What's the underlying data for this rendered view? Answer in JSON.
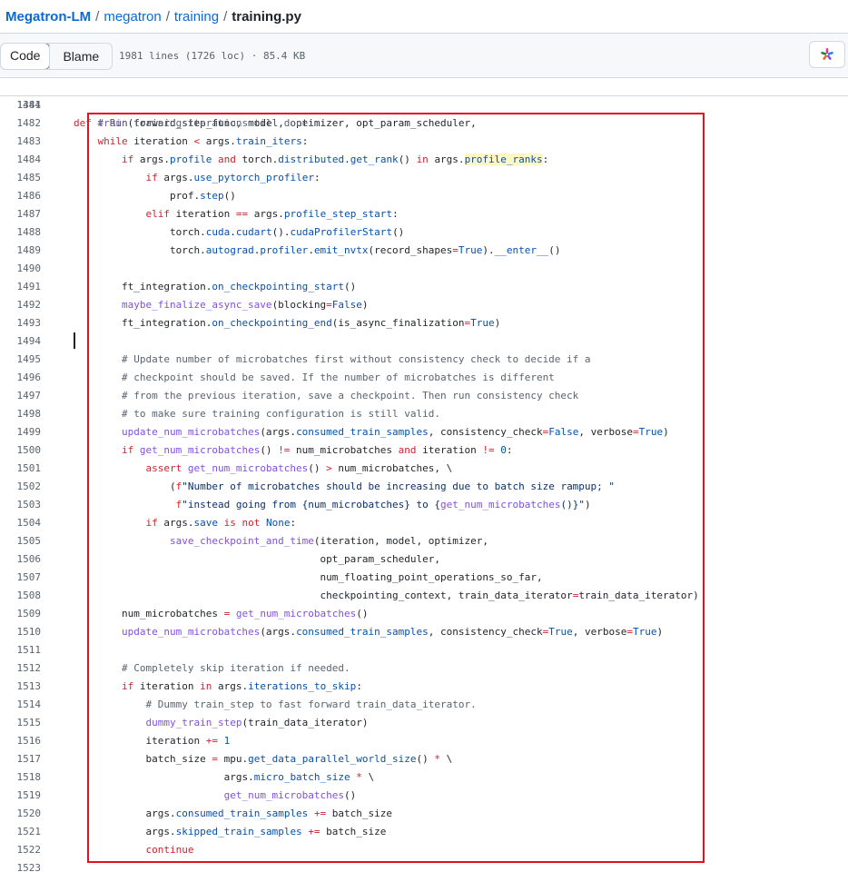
{
  "breadcrumb": {
    "repo": "Megatron-LM",
    "dir1": "megatron",
    "dir2": "training",
    "file": "training.py",
    "separator": "/"
  },
  "toolbar": {
    "code_tab": "Code",
    "blame_tab": "Blame",
    "file_meta": "1981 lines (1726 loc) · 85.4 KB",
    "copilot_icon": "copilot-sparkle-icon"
  },
  "annotation": {
    "box_color": "#e5101f"
  },
  "sticky_line": {
    "num": "1344",
    "tokens": [
      {
        "t": "def ",
        "c": "kw"
      },
      {
        "t": "train",
        "c": "fn"
      },
      {
        "t": "(forward_step_func, model, optimizer, opt_param_scheduler,",
        "c": ""
      }
    ]
  },
  "lines": [
    {
      "num": "1481",
      "indent": 0,
      "tokens": []
    },
    {
      "num": "1482",
      "indent": 4,
      "tokens": [
        {
          "t": "# Run training iterations till done.",
          "c": "cm"
        }
      ]
    },
    {
      "num": "1483",
      "indent": 4,
      "tokens": [
        {
          "t": "while ",
          "c": "kw"
        },
        {
          "t": "iteration ",
          "c": ""
        },
        {
          "t": "<",
          "c": "kw"
        },
        {
          "t": " args.",
          "c": ""
        },
        {
          "t": "train_iters",
          "c": "at"
        },
        {
          "t": ":",
          "c": ""
        }
      ]
    },
    {
      "num": "1484",
      "indent": 8,
      "tokens": [
        {
          "t": "if ",
          "c": "kw"
        },
        {
          "t": "args.",
          "c": ""
        },
        {
          "t": "profile ",
          "c": "at"
        },
        {
          "t": "and ",
          "c": "kw"
        },
        {
          "t": "torch.",
          "c": ""
        },
        {
          "t": "distributed",
          "c": "at"
        },
        {
          "t": ".",
          "c": ""
        },
        {
          "t": "get_rank",
          "c": "at"
        },
        {
          "t": "() ",
          "c": ""
        },
        {
          "t": "in ",
          "c": "kw"
        },
        {
          "t": "args.",
          "c": ""
        },
        {
          "t": "profile_ranks",
          "c": "at hl"
        },
        {
          "t": ":",
          "c": ""
        }
      ]
    },
    {
      "num": "1485",
      "indent": 12,
      "tokens": [
        {
          "t": "if ",
          "c": "kw"
        },
        {
          "t": "args.",
          "c": ""
        },
        {
          "t": "use_pytorch_profiler",
          "c": "at"
        },
        {
          "t": ":",
          "c": ""
        }
      ]
    },
    {
      "num": "1486",
      "indent": 16,
      "tokens": [
        {
          "t": "prof.",
          "c": ""
        },
        {
          "t": "step",
          "c": "at"
        },
        {
          "t": "()",
          "c": ""
        }
      ]
    },
    {
      "num": "1487",
      "indent": 12,
      "tokens": [
        {
          "t": "elif ",
          "c": "kw"
        },
        {
          "t": "iteration ",
          "c": ""
        },
        {
          "t": "==",
          "c": "kw"
        },
        {
          "t": " args.",
          "c": ""
        },
        {
          "t": "profile_step_start",
          "c": "at"
        },
        {
          "t": ":",
          "c": ""
        }
      ]
    },
    {
      "num": "1488",
      "indent": 16,
      "tokens": [
        {
          "t": "torch.",
          "c": ""
        },
        {
          "t": "cuda",
          "c": "at"
        },
        {
          "t": ".",
          "c": ""
        },
        {
          "t": "cudart",
          "c": "at"
        },
        {
          "t": "().",
          "c": ""
        },
        {
          "t": "cudaProfilerStart",
          "c": "at"
        },
        {
          "t": "()",
          "c": ""
        }
      ]
    },
    {
      "num": "1489",
      "indent": 16,
      "tokens": [
        {
          "t": "torch.",
          "c": ""
        },
        {
          "t": "autograd",
          "c": "at"
        },
        {
          "t": ".",
          "c": ""
        },
        {
          "t": "profiler",
          "c": "at"
        },
        {
          "t": ".",
          "c": ""
        },
        {
          "t": "emit_nvtx",
          "c": "at"
        },
        {
          "t": "(record_shapes",
          "c": ""
        },
        {
          "t": "=",
          "c": "kw"
        },
        {
          "t": "True",
          "c": "at"
        },
        {
          "t": ").",
          "c": ""
        },
        {
          "t": "__enter__",
          "c": "at"
        },
        {
          "t": "()",
          "c": ""
        }
      ]
    },
    {
      "num": "1490",
      "indent": 0,
      "tokens": []
    },
    {
      "num": "1491",
      "indent": 8,
      "tokens": [
        {
          "t": "ft_integration.",
          "c": ""
        },
        {
          "t": "on_checkpointing_start",
          "c": "at"
        },
        {
          "t": "()",
          "c": ""
        }
      ]
    },
    {
      "num": "1492",
      "indent": 8,
      "tokens": [
        {
          "t": "maybe_finalize_async_save",
          "c": "fn"
        },
        {
          "t": "(blocking",
          "c": ""
        },
        {
          "t": "=",
          "c": "kw"
        },
        {
          "t": "False",
          "c": "at"
        },
        {
          "t": ")",
          "c": ""
        }
      ]
    },
    {
      "num": "1493",
      "indent": 8,
      "tokens": [
        {
          "t": "ft_integration.",
          "c": ""
        },
        {
          "t": "on_checkpointing_end",
          "c": "at"
        },
        {
          "t": "(is_async_finalization",
          "c": ""
        },
        {
          "t": "=",
          "c": "kw"
        },
        {
          "t": "True",
          "c": "at"
        },
        {
          "t": ")",
          "c": ""
        }
      ]
    },
    {
      "num": "1494",
      "indent": 0,
      "tokens": []
    },
    {
      "num": "1495",
      "indent": 8,
      "tokens": [
        {
          "t": "# Update number of microbatches first without consistency check to decide if a",
          "c": "cm"
        }
      ]
    },
    {
      "num": "1496",
      "indent": 8,
      "tokens": [
        {
          "t": "# checkpoint should be saved. If the number of microbatches is different",
          "c": "cm"
        }
      ]
    },
    {
      "num": "1497",
      "indent": 8,
      "tokens": [
        {
          "t": "# from the previous iteration, save a checkpoint. Then run consistency check",
          "c": "cm"
        }
      ]
    },
    {
      "num": "1498",
      "indent": 8,
      "tokens": [
        {
          "t": "# to make sure training configuration is still valid.",
          "c": "cm"
        }
      ]
    },
    {
      "num": "1499",
      "indent": 8,
      "tokens": [
        {
          "t": "update_num_microbatches",
          "c": "fn"
        },
        {
          "t": "(args.",
          "c": ""
        },
        {
          "t": "consumed_train_samples",
          "c": "at"
        },
        {
          "t": ", consistency_check",
          "c": ""
        },
        {
          "t": "=",
          "c": "kw"
        },
        {
          "t": "False",
          "c": "at"
        },
        {
          "t": ", verbose",
          "c": ""
        },
        {
          "t": "=",
          "c": "kw"
        },
        {
          "t": "True",
          "c": "at"
        },
        {
          "t": ")",
          "c": ""
        }
      ]
    },
    {
      "num": "1500",
      "indent": 8,
      "tokens": [
        {
          "t": "if ",
          "c": "kw"
        },
        {
          "t": "get_num_microbatches",
          "c": "fn"
        },
        {
          "t": "() ",
          "c": ""
        },
        {
          "t": "!=",
          "c": "kw"
        },
        {
          "t": " num_microbatches ",
          "c": ""
        },
        {
          "t": "and ",
          "c": "kw"
        },
        {
          "t": "iteration ",
          "c": ""
        },
        {
          "t": "!=",
          "c": "kw"
        },
        {
          "t": " ",
          "c": ""
        },
        {
          "t": "0",
          "c": "at"
        },
        {
          "t": ":",
          "c": ""
        }
      ]
    },
    {
      "num": "1501",
      "indent": 12,
      "tokens": [
        {
          "t": "assert ",
          "c": "kw"
        },
        {
          "t": "get_num_microbatches",
          "c": "fn"
        },
        {
          "t": "() ",
          "c": ""
        },
        {
          "t": ">",
          "c": "kw"
        },
        {
          "t": " num_microbatches, \\",
          "c": ""
        }
      ]
    },
    {
      "num": "1502",
      "indent": 16,
      "tokens": [
        {
          "t": "(",
          "c": ""
        },
        {
          "t": "f",
          "c": "kw"
        },
        {
          "t": "\"Number of microbatches should be increasing due to batch size rampup; \"",
          "c": "st"
        }
      ]
    },
    {
      "num": "1503",
      "indent": 17,
      "tokens": [
        {
          "t": "f",
          "c": "kw"
        },
        {
          "t": "\"instead going from {num_microbatches} to {",
          "c": "st"
        },
        {
          "t": "get_num_microbatches",
          "c": "fn"
        },
        {
          "t": "()}\"",
          "c": "st"
        },
        {
          "t": ")",
          "c": ""
        }
      ]
    },
    {
      "num": "1504",
      "indent": 12,
      "tokens": [
        {
          "t": "if ",
          "c": "kw"
        },
        {
          "t": "args.",
          "c": ""
        },
        {
          "t": "save ",
          "c": "at"
        },
        {
          "t": "is not ",
          "c": "kw"
        },
        {
          "t": "None",
          "c": "at"
        },
        {
          "t": ":",
          "c": ""
        }
      ]
    },
    {
      "num": "1505",
      "indent": 16,
      "tokens": [
        {
          "t": "save_checkpoint_and_time",
          "c": "fn"
        },
        {
          "t": "(iteration, model, optimizer,",
          "c": ""
        }
      ]
    },
    {
      "num": "1506",
      "indent": 41,
      "tokens": [
        {
          "t": "opt_param_scheduler,",
          "c": ""
        }
      ]
    },
    {
      "num": "1507",
      "indent": 41,
      "tokens": [
        {
          "t": "num_floating_point_operations_so_far,",
          "c": ""
        }
      ]
    },
    {
      "num": "1508",
      "indent": 41,
      "tokens": [
        {
          "t": "checkpointing_context, train_data_iterator",
          "c": ""
        },
        {
          "t": "=",
          "c": "kw"
        },
        {
          "t": "train_data_iterator)",
          "c": ""
        }
      ]
    },
    {
      "num": "1509",
      "indent": 8,
      "tokens": [
        {
          "t": "num_microbatches ",
          "c": ""
        },
        {
          "t": "=",
          "c": "kw"
        },
        {
          "t": " ",
          "c": ""
        },
        {
          "t": "get_num_microbatches",
          "c": "fn"
        },
        {
          "t": "()",
          "c": ""
        }
      ]
    },
    {
      "num": "1510",
      "indent": 8,
      "tokens": [
        {
          "t": "update_num_microbatches",
          "c": "fn"
        },
        {
          "t": "(args.",
          "c": ""
        },
        {
          "t": "consumed_train_samples",
          "c": "at"
        },
        {
          "t": ", consistency_check",
          "c": ""
        },
        {
          "t": "=",
          "c": "kw"
        },
        {
          "t": "True",
          "c": "at"
        },
        {
          "t": ", verbose",
          "c": ""
        },
        {
          "t": "=",
          "c": "kw"
        },
        {
          "t": "True",
          "c": "at"
        },
        {
          "t": ")",
          "c": ""
        }
      ]
    },
    {
      "num": "1511",
      "indent": 0,
      "tokens": []
    },
    {
      "num": "1512",
      "indent": 8,
      "tokens": [
        {
          "t": "# Completely skip iteration if needed.",
          "c": "cm"
        }
      ]
    },
    {
      "num": "1513",
      "indent": 8,
      "tokens": [
        {
          "t": "if ",
          "c": "kw"
        },
        {
          "t": "iteration ",
          "c": ""
        },
        {
          "t": "in ",
          "c": "kw"
        },
        {
          "t": "args.",
          "c": ""
        },
        {
          "t": "iterations_to_skip",
          "c": "at"
        },
        {
          "t": ":",
          "c": ""
        }
      ]
    },
    {
      "num": "1514",
      "indent": 12,
      "tokens": [
        {
          "t": "# Dummy train_step to fast forward train_data_iterator.",
          "c": "cm"
        }
      ]
    },
    {
      "num": "1515",
      "indent": 12,
      "tokens": [
        {
          "t": "dummy_train_step",
          "c": "fn"
        },
        {
          "t": "(train_data_iterator)",
          "c": ""
        }
      ]
    },
    {
      "num": "1516",
      "indent": 12,
      "tokens": [
        {
          "t": "iteration ",
          "c": ""
        },
        {
          "t": "+=",
          "c": "kw"
        },
        {
          "t": " ",
          "c": ""
        },
        {
          "t": "1",
          "c": "at"
        }
      ]
    },
    {
      "num": "1517",
      "indent": 12,
      "tokens": [
        {
          "t": "batch_size ",
          "c": ""
        },
        {
          "t": "=",
          "c": "kw"
        },
        {
          "t": " mpu.",
          "c": ""
        },
        {
          "t": "get_data_parallel_world_size",
          "c": "at"
        },
        {
          "t": "() ",
          "c": ""
        },
        {
          "t": "*",
          "c": "kw"
        },
        {
          "t": " \\",
          "c": ""
        }
      ]
    },
    {
      "num": "1518",
      "indent": 25,
      "tokens": [
        {
          "t": "args.",
          "c": ""
        },
        {
          "t": "micro_batch_size ",
          "c": "at"
        },
        {
          "t": "*",
          "c": "kw"
        },
        {
          "t": " \\",
          "c": ""
        }
      ]
    },
    {
      "num": "1519",
      "indent": 25,
      "tokens": [
        {
          "t": "get_num_microbatches",
          "c": "fn"
        },
        {
          "t": "()",
          "c": ""
        }
      ]
    },
    {
      "num": "1520",
      "indent": 12,
      "tokens": [
        {
          "t": "args.",
          "c": ""
        },
        {
          "t": "consumed_train_samples ",
          "c": "at"
        },
        {
          "t": "+=",
          "c": "kw"
        },
        {
          "t": " batch_size",
          "c": ""
        }
      ]
    },
    {
      "num": "1521",
      "indent": 12,
      "tokens": [
        {
          "t": "args.",
          "c": ""
        },
        {
          "t": "skipped_train_samples ",
          "c": "at"
        },
        {
          "t": "+=",
          "c": "kw"
        },
        {
          "t": " batch_size",
          "c": ""
        }
      ]
    },
    {
      "num": "1522",
      "indent": 12,
      "tokens": [
        {
          "t": "continue",
          "c": "kw"
        }
      ]
    },
    {
      "num": "1523",
      "indent": 0,
      "tokens": []
    }
  ]
}
